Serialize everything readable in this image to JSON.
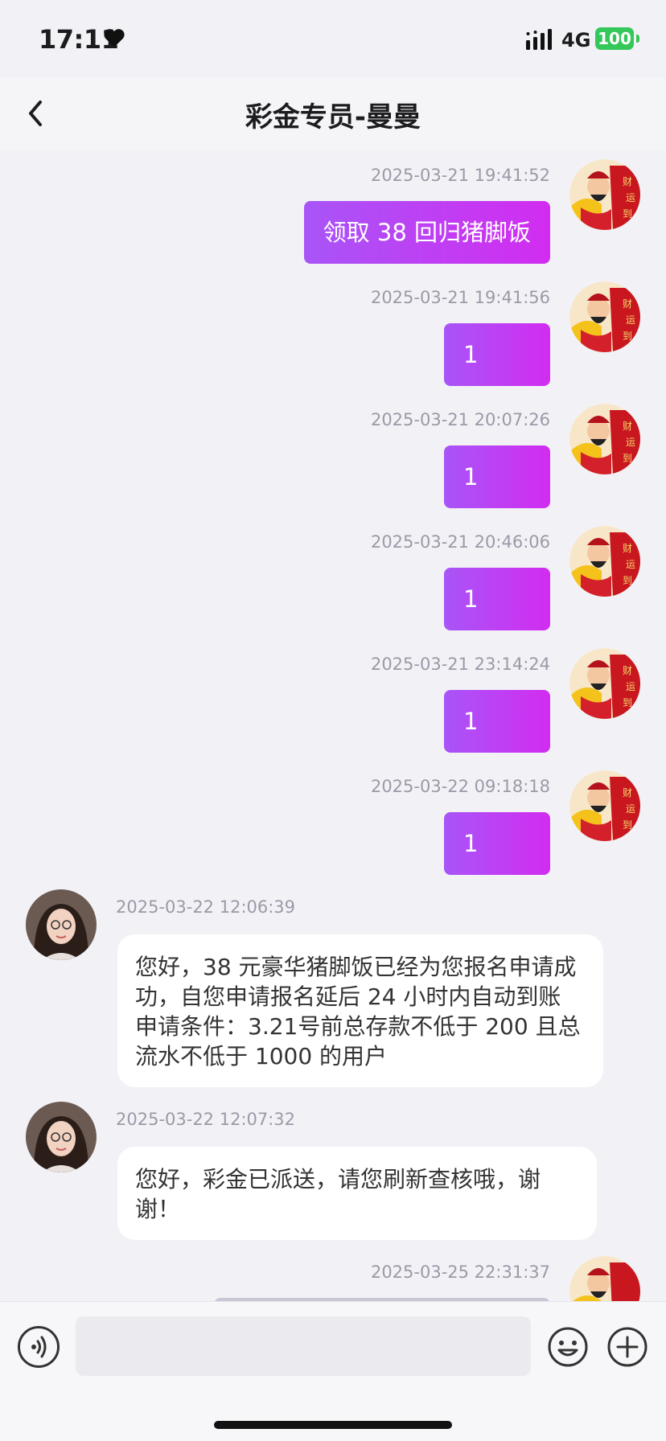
{
  "status_bar": {
    "time": "17:11",
    "network": "4G",
    "battery": "100"
  },
  "nav": {
    "title": "彩金专员-曼曼"
  },
  "messages": [
    {
      "side": "out",
      "timestamp": "2025-03-21 19:41:52",
      "text": "领取 38 回归猪脚饭"
    },
    {
      "side": "out",
      "timestamp": "2025-03-21 19:41:56",
      "text": "1"
    },
    {
      "side": "out",
      "timestamp": "2025-03-21 20:07:26",
      "text": "1"
    },
    {
      "side": "out",
      "timestamp": "2025-03-21 20:46:06",
      "text": "1"
    },
    {
      "side": "out",
      "timestamp": "2025-03-21 23:14:24",
      "text": "1"
    },
    {
      "side": "out",
      "timestamp": "2025-03-22 09:18:18",
      "text": "1"
    },
    {
      "side": "in",
      "timestamp": "2025-03-22 12:06:39",
      "text": "您好，38 元豪华猪脚饭已经为您报名申请成功，自您申请报名延后 24 小时内自动到账 申请条件：3.21号前总存款不低于 200 且总流水不低于 1000 的用户"
    },
    {
      "side": "in",
      "timestamp": "2025-03-22 12:07:32",
      "text": "您好，彩金已派送，请您刷新查核哦，谢谢！"
    },
    {
      "side": "out",
      "timestamp": "2025-03-25 22:31:37",
      "text": ""
    }
  ],
  "input": {
    "placeholder": ""
  },
  "icons": {
    "back": "chevron-left-icon",
    "voice": "voice-icon",
    "emoji": "emoji-icon",
    "plus": "plus-icon"
  },
  "colors": {
    "bubble_out_start": "#a855f7",
    "bubble_out_end": "#d22cf0",
    "battery": "#34c759"
  }
}
